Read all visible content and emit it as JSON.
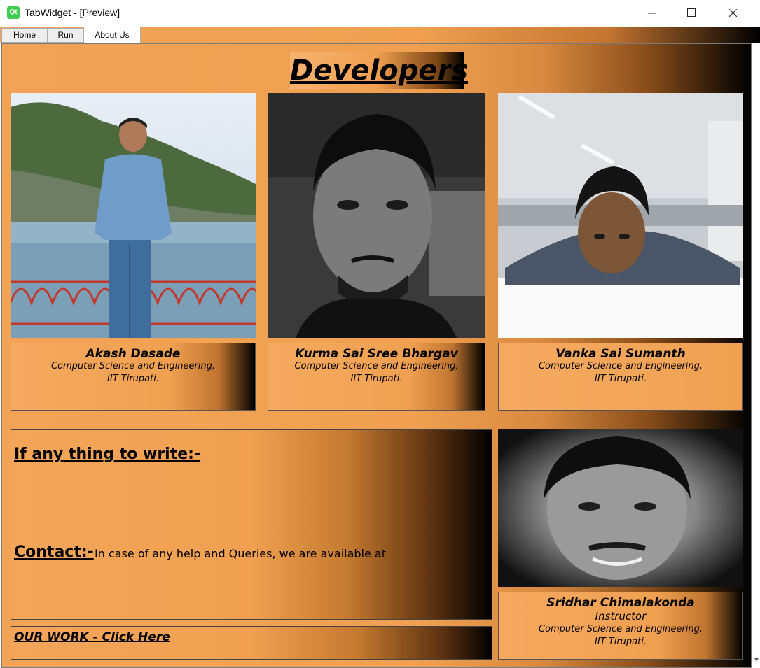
{
  "window": {
    "app_icon": "Qt",
    "title": "TabWidget - [Preview]"
  },
  "tabs": [
    {
      "label": "Home",
      "active": false
    },
    {
      "label": "Run",
      "active": false
    },
    {
      "label": "About Us",
      "active": true
    }
  ],
  "about": {
    "heading": "Developers",
    "developers": [
      {
        "name": "Akash Dasade",
        "dept": "Computer Science and Engineering,",
        "inst": "IIT Tirupati."
      },
      {
        "name": "Kurma Sai Sree Bhargav",
        "dept": "Computer Science and Engineering,",
        "inst": "IIT Tirupati."
      },
      {
        "name": "Vanka Sai Sumanth",
        "dept": "Computer Science and Engineering,",
        "inst": "IIT Tirupati."
      }
    ],
    "write_label": "If any thing to write:-",
    "contact_label": "Contact:-",
    "contact_text": "In case of any help and Queries, we are available at",
    "work_link": "OUR WORK - Click Here",
    "instructor": {
      "name": "Sridhar Chimalakonda",
      "role": "Instructor",
      "dept": "Computer Science and Engineering,",
      "inst": "IIT Tirupati."
    }
  },
  "colors": {
    "panel_orange": "#f0a050",
    "panel_dark": "#000000"
  }
}
